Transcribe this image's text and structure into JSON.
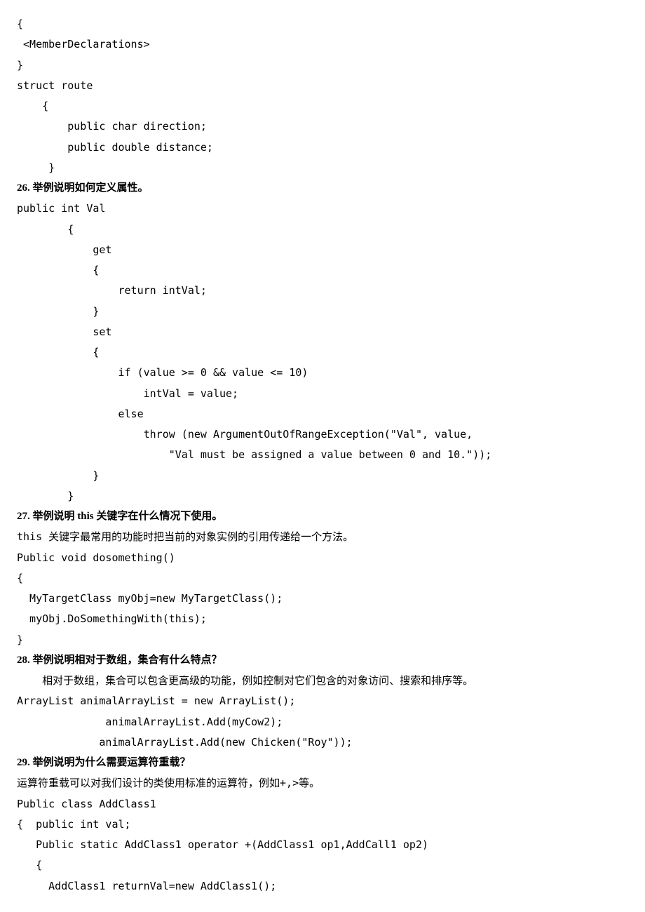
{
  "block1": {
    "l1": "{",
    "l2": " <MemberDeclarations>",
    "l3": "}",
    "l4": "struct route",
    "l5": "    {",
    "l6": "        public char direction;",
    "l7": "        public double distance;",
    "l8": "     }"
  },
  "q26": {
    "title": "26. 举例说明如何定义属性。",
    "l1": "public int Val",
    "l2": "        {",
    "l3": "            get",
    "l4": "            {",
    "l5": "                return intVal;",
    "l6": "            }",
    "l7": "            set",
    "l8": "            {",
    "l9": "                if (value >= 0 && value <= 10)",
    "l10": "                    intVal = value;",
    "l11": "                else",
    "l12": "                    throw (new ArgumentOutOfRangeException(\"Val\", value,",
    "l13": "                        \"Val must be assigned a value between 0 and 10.\"));",
    "l14": "            }",
    "l15": "        }"
  },
  "q27": {
    "title": "27. 举例说明 this 关键字在什么情况下使用。",
    "l1": "this 关键字最常用的功能时把当前的对象实例的引用传递给一个方法。",
    "l2": "Public void dosomething()",
    "l3": "{",
    "l4": "  MyTargetClass myObj=new MyTargetClass();",
    "l5": "  myObj.DoSomethingWith(this);",
    "l6": "}"
  },
  "q28": {
    "title": "28. 举例说明相对于数组，集合有什么特点？",
    "l1": "    相对于数组，集合可以包含更高级的功能，例如控制对它们包含的对象访问、搜索和排序等。",
    "l2": "ArrayList animalArrayList = new ArrayList();",
    "l3": "              animalArrayList.Add(myCow2);",
    "l4": "             animalArrayList.Add(new Chicken(\"Roy\"));"
  },
  "q29": {
    "title": "29. 举例说明为什么需要运算符重载？",
    "l1": "运算符重载可以对我们设计的类使用标准的运算符，例如+,>等。",
    "l2": "Public class AddClass1",
    "l3": "{  public int val;",
    "l4": "   Public static AddClass1 operator +(AddClass1 op1,AddCall1 op2)",
    "l5": "   {",
    "l6": "     AddClass1 returnVal=new AddClass1();"
  }
}
